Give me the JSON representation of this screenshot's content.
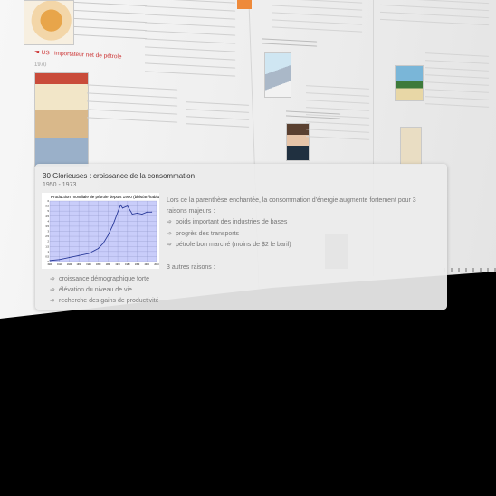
{
  "background": {
    "oil_caption": "☚ US : importateur net de pétrole",
    "oil_year": "1970"
  },
  "popup": {
    "title": "30 Glorieuses : croissance de la consommation",
    "period": "1950 - 1973",
    "description": "Lors ce la parenthèse enchantée, la consommation d'énergie augmente fortement pour 3 raisons majeurs :",
    "reasons": [
      "poids important des industries de bases",
      "progrès des transports",
      "pétrole bon marché (moins de $2 le baril)"
    ],
    "other_label": "3 autres raisons :",
    "other_reasons": [
      "croissance démographique forte",
      "élévation du niveau de vie",
      "recherche des gains de productivité"
    ],
    "bullet_icon": "arrow-bullet-icon"
  },
  "chart_data": {
    "type": "line",
    "title": "Production mondiale de pétrole depuis 1900 (bbls/an/habitant)",
    "x": [
      1900,
      1910,
      1920,
      1930,
      1940,
      1950,
      1955,
      1960,
      1965,
      1970,
      1973,
      1975,
      1980,
      1985,
      1990,
      1995,
      2000,
      2005
    ],
    "values": [
      0.1,
      0.2,
      0.4,
      0.6,
      0.8,
      1.3,
      1.8,
      2.6,
      3.6,
      4.9,
      5.6,
      5.3,
      5.5,
      4.7,
      4.8,
      4.7,
      4.9,
      4.9
    ],
    "xlim": [
      1900,
      2010
    ],
    "ylim": [
      0,
      6
    ],
    "xticks": [
      "1900",
      "1910",
      "1920",
      "1930",
      "1940",
      "1950",
      "1960",
      "1970",
      "1980",
      "1990",
      "2000",
      "2010"
    ],
    "yticks": [
      "0",
      "0.5",
      "1",
      "1.5",
      "2",
      "2.5",
      "3",
      "3.5",
      "4",
      "4.5",
      "5",
      "5.5",
      "6"
    ],
    "grid": true,
    "colors": {
      "plot_bg": "#c9cdfa",
      "line": "#2a3a9a"
    }
  }
}
